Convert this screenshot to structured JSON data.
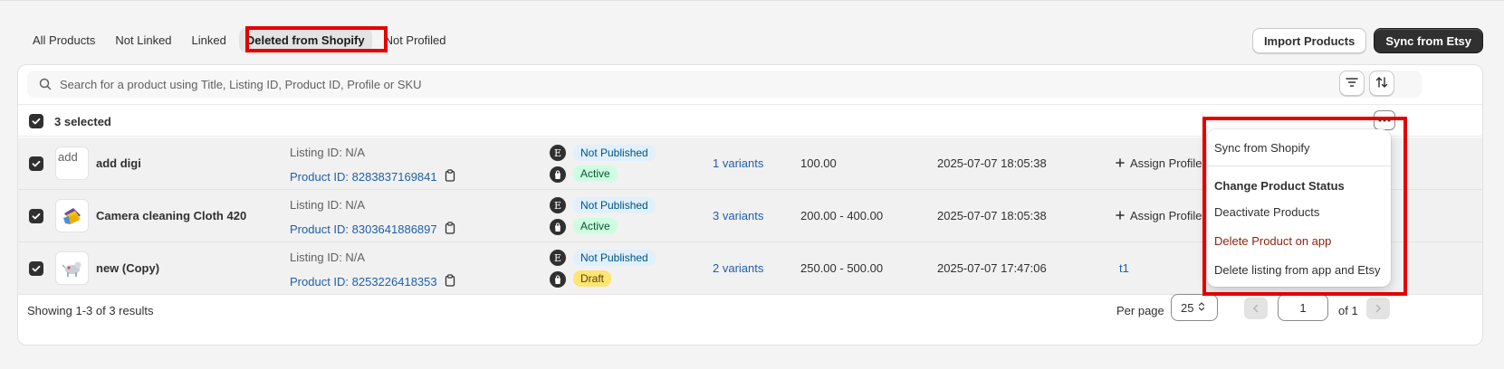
{
  "tabs": [
    {
      "label": "All Products"
    },
    {
      "label": "Not Linked"
    },
    {
      "label": "Linked"
    },
    {
      "label": "Deleted from Shopify"
    },
    {
      "label": "Not Profiled"
    }
  ],
  "header": {
    "import_label": "Import Products",
    "sync_label": "Sync from Etsy"
  },
  "search": {
    "placeholder": "Search for a product using Title, Listing ID, Product ID, Profile or SKU"
  },
  "selection": {
    "label": "3 selected"
  },
  "rows": [
    {
      "image_alt": "add",
      "title": "add digi",
      "listing": "Listing ID: N/A",
      "product_id": "Product ID: 8283837169841",
      "etsy_status": "Not Published",
      "shopify_status": "Active",
      "variants": "1 variants",
      "price": "100.00",
      "date": "2025-07-07 18:05:38",
      "profile": "Assign Profile"
    },
    {
      "title": "Camera cleaning Cloth 420",
      "listing": "Listing ID: N/A",
      "product_id": "Product ID: 8303641886897",
      "etsy_status": "Not Published",
      "shopify_status": "Active",
      "variants": "3 variants",
      "price": "200.00 - 400.00",
      "date": "2025-07-07 18:05:38",
      "profile": "Assign Profile"
    },
    {
      "title": "new (Copy)",
      "listing": "Listing ID: N/A",
      "product_id": "Product ID: 8253226418353",
      "etsy_status": "Not Published",
      "shopify_status": "Draft",
      "variants": "2 variants",
      "price": "250.00 - 500.00",
      "date": "2025-07-07 17:47:06",
      "profile": "t1"
    }
  ],
  "channel_icons": {
    "etsy": "E"
  },
  "footer": {
    "showing": "Showing 1-3 of 3 results",
    "per_page_label": "Per page",
    "per_page_value": "25",
    "page_value": "1",
    "of_label": "of 1"
  },
  "menu": {
    "sync": "Sync from Shopify",
    "heading": "Change Product Status",
    "deactivate": "Deactivate Products",
    "delete_app": "Delete Product on app",
    "delete_all": "Delete listing from app and Etsy"
  },
  "colors": {
    "highlight": "#e40000",
    "link": "#1f5fa8",
    "badge_info": "#e0f0ff",
    "badge_success": "#cdfee1",
    "badge_warn": "#ffe476"
  }
}
